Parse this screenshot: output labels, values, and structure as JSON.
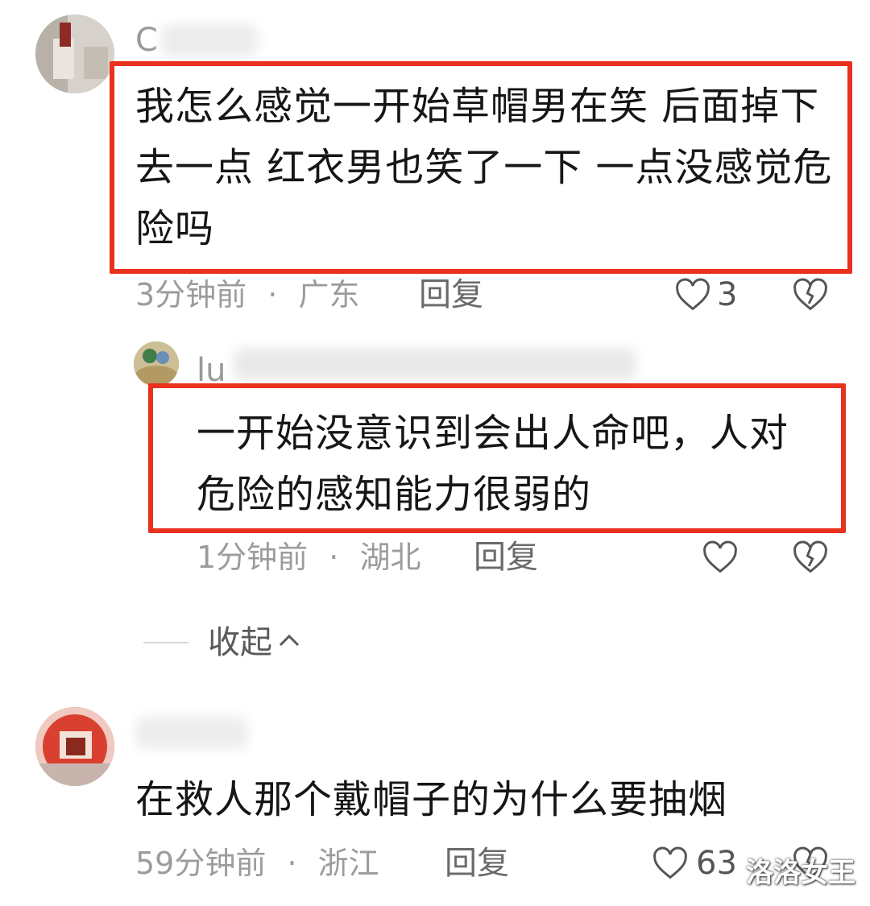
{
  "comments": [
    {
      "username": "C",
      "text": "我怎么感觉一开始草帽男在笑 后面掉下去一点 红衣男也笑了一下 一点没感觉危险吗",
      "time": "3分钟前",
      "location": "广东",
      "reply_label": "回复",
      "likes": "3"
    },
    {
      "username": "lu",
      "text": "一开始没意识到会出人命吧，人对危险的感知能力很弱的",
      "time": "1分钟前",
      "location": "湖北",
      "reply_label": "回复",
      "likes": ""
    },
    {
      "username": "",
      "text": "在救人那个戴帽子的为什么要抽烟",
      "time": "59分钟前",
      "location": "浙江",
      "reply_label": "回复",
      "likes": "63"
    }
  ],
  "collapse_label": "收起",
  "separator": "·",
  "watermark": "洛洛女王",
  "colors": {
    "highlight_border": "#e8321e",
    "meta_text": "#9c9c9c"
  },
  "icons": [
    "heart-icon",
    "broken-heart-icon",
    "chevron-up-icon"
  ]
}
